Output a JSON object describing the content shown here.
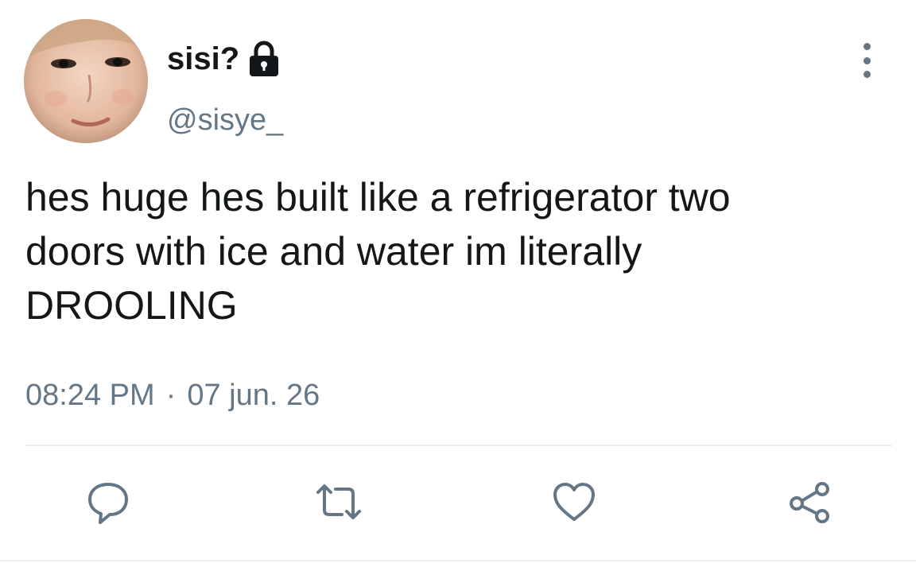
{
  "user": {
    "display_name": "sisi?",
    "handle": "@sisye_",
    "protected_icon": "lock-icon",
    "avatar": "profile-photo"
  },
  "tweet": {
    "text": "hes huge hes built like a refrigerator two\ndoors with ice and water im literally\nDROOLING",
    "time": "08:24 PM",
    "separator": "·",
    "date": "07 jun. 26"
  },
  "menu": {
    "icon": "more-vertical-icon"
  },
  "actions": [
    {
      "name": "reply",
      "icon": "reply-icon"
    },
    {
      "name": "retweet",
      "icon": "retweet-icon"
    },
    {
      "name": "like",
      "icon": "heart-icon"
    },
    {
      "name": "share",
      "icon": "share-icon"
    }
  ],
  "colors": {
    "text": "#14171a",
    "secondary": "#657786",
    "divider": "#e6ecf0"
  }
}
